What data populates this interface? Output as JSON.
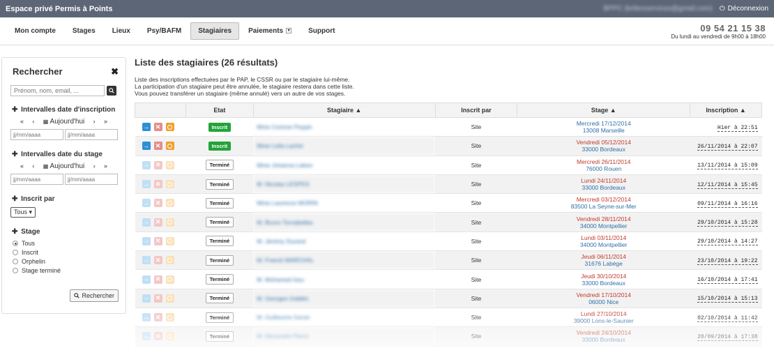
{
  "topbar": {
    "brand": "Espace privé Permis à Points",
    "email": "BPPC (bribesservices@gmail.com)",
    "logout": "Déconnexion"
  },
  "nav": {
    "tabs": [
      "Mon compte",
      "Stages",
      "Lieux",
      "Psy/BAFM",
      "Stagiaires",
      "Paiements",
      "Support"
    ],
    "active": "Stagiaires",
    "phone": "09 54 21 15 38",
    "hours": "Du lundi au vendredi de 9h00 à 18h00"
  },
  "sidebar": {
    "title": "Rechercher",
    "close": "✖",
    "search_placeholder": "Prénom, nom, email, ...",
    "sec_inscription": "Intervalles date d'inscription",
    "sec_stage_dates": "Intervalles date du stage",
    "today": "Aujourd'hui",
    "nav": {
      "first": "«",
      "prev": "‹",
      "next": "›",
      "last": "»"
    },
    "date_placeholder": "jj/mm/aaaa",
    "sec_inscrit_par": "Inscrit par",
    "inscrit_par_value": "Tous",
    "sec_stage": "Stage",
    "stage_options": [
      "Tous",
      "Inscrit",
      "Orphelin",
      "Stage terminé"
    ],
    "button": "Rechercher"
  },
  "main": {
    "title": "Liste des stagiaires",
    "count": "(26 résultats)",
    "desc": [
      "Liste des inscriptions effectuées par le PAP, le CSSR ou par le stagiaire lui-même.",
      "La participation d'un stagiaire peut être annulée, le stagiaire restera dans cette liste.",
      "Vous pouvez transférer un stagiaire (même annulé) vers un autre de vos stages."
    ],
    "headers": {
      "etat": "Etat",
      "stagiaire": "Stagiaire ▲",
      "inscrit_par": "Inscrit par",
      "stage": "Stage ▲",
      "inscription": "Inscription ▲"
    },
    "rows": [
      {
        "etat": "Inscrit",
        "name": "Mme Corinne Peypin",
        "par": "Site",
        "date": "Mercredi 17/12/2014",
        "city": "13008 Marseille",
        "insc": "Hier à 22:51",
        "future": true
      },
      {
        "etat": "Inscrit",
        "name": "Mme Leila Lachiri",
        "par": "Site",
        "date": "Vendredi 05/12/2014",
        "city": "33000 Bordeaux",
        "insc": "26/11/2014 à 22:07",
        "future": true
      },
      {
        "etat": "Terminé",
        "name": "Mme Johanna Lebon",
        "par": "Site",
        "date": "Mercredi 26/11/2014",
        "city": "76000 Rouen",
        "insc": "13/11/2014 à 15:09",
        "future": false
      },
      {
        "etat": "Terminé",
        "name": "M. Nicolas LESPES",
        "par": "Site",
        "date": "Lundi 24/11/2014",
        "city": "33000 Bordeaux",
        "insc": "12/11/2014 à 15:45",
        "future": false
      },
      {
        "etat": "Terminé",
        "name": "Mme Laurence MORIN",
        "par": "Site",
        "date": "Mercredi 03/12/2014",
        "city": "83500 La Seyne-sur-Mer",
        "insc": "09/11/2014 à 16:16",
        "future": false
      },
      {
        "etat": "Terminé",
        "name": "M. Bruno Tornabelles",
        "par": "Site",
        "date": "Vendredi 28/11/2014",
        "city": "34000 Montpellier",
        "insc": "29/10/2014 à 15:28",
        "future": false
      },
      {
        "etat": "Terminé",
        "name": "M. Jérémy Durand",
        "par": "Site",
        "date": "Lundi 03/11/2014",
        "city": "34000 Montpellier",
        "insc": "29/10/2014 à 14:27",
        "future": false
      },
      {
        "etat": "Terminé",
        "name": "M. Franck MARCHAL",
        "par": "Site",
        "date": "Jeudi 06/11/2014",
        "city": "31676 Labège",
        "insc": "23/10/2014 à 19:22",
        "future": false
      },
      {
        "etat": "Terminé",
        "name": "M. Mohamed Issu",
        "par": "Site",
        "date": "Jeudi 30/10/2014",
        "city": "33000 Bordeaux",
        "insc": "16/10/2014 à 17:41",
        "future": false
      },
      {
        "etat": "Terminé",
        "name": "M. Georges Galdès",
        "par": "Site",
        "date": "Vendredi 17/10/2014",
        "city": "06000 Nice",
        "insc": "15/10/2014 à 15:13",
        "future": false
      },
      {
        "etat": "Terminé",
        "name": "M. Guillaume Genet",
        "par": "Site",
        "date": "Lundi 27/10/2014",
        "city": "39000 Lons-le-Saunier",
        "insc": "02/10/2014 à 11:42",
        "future": false
      },
      {
        "etat": "Terminé",
        "name": "M. Alexandre Pierre",
        "par": "Site",
        "date": "Vendredi 24/10/2014",
        "city": "33000 Bordeaux",
        "insc": "20/09/2014 à 17:38",
        "future": false
      }
    ]
  },
  "icons": {
    "arrow": "→",
    "delete": "✕",
    "calendar": "📅",
    "search": "🔍",
    "logout": "⏻",
    "plus": "✚"
  },
  "colors": {
    "topbar": "#5c6677",
    "inscrit": "#23a33a",
    "link": "#2f6fa8",
    "date_red": "#c0392b"
  }
}
